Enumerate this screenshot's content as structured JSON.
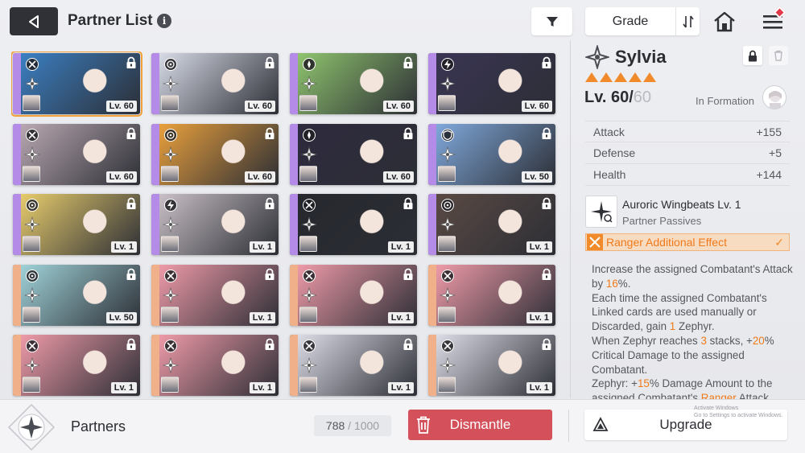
{
  "header": {
    "title": "Partner List",
    "info_icon": "info-icon",
    "grade_label": "Grade",
    "filter_icon": "filter-icon",
    "sort_icon": "sort-icon",
    "home_icon": "home-icon",
    "menu_icon": "menu-icon"
  },
  "partners": [
    {
      "level": "Lv. 60",
      "class": "crossed-swords",
      "stripe": "#b58be8",
      "art": "#3b7fc2",
      "selected": true
    },
    {
      "level": "Lv. 60",
      "class": "target",
      "stripe": "#b58be8",
      "art": "#d7dbe6"
    },
    {
      "level": "Lv. 60",
      "class": "compass",
      "stripe": "#b58be8",
      "art": "#8fc46e"
    },
    {
      "level": "Lv. 60",
      "class": "lightning",
      "stripe": "#b58be8",
      "art": "#3a3554"
    },
    {
      "level": "Lv. 60",
      "class": "crossed-swords",
      "stripe": "#b58be8",
      "art": "#b9a8b2"
    },
    {
      "level": "Lv. 60",
      "class": "target",
      "stripe": "#b58be8",
      "art": "#e9a03c"
    },
    {
      "level": "Lv. 60",
      "class": "compass",
      "stripe": "#b58be8",
      "art": "#2e2a3e"
    },
    {
      "level": "Lv. 50",
      "class": "shield",
      "stripe": "#b58be8",
      "art": "#7fa8db"
    },
    {
      "level": "Lv. 1",
      "class": "target",
      "stripe": "#b58be8",
      "art": "#e7cc6c"
    },
    {
      "level": "Lv. 1",
      "class": "lightning",
      "stripe": "#b58be8",
      "art": "#c9c0c6"
    },
    {
      "level": "Lv. 1",
      "class": "crossed-swords",
      "stripe": "#b58be8",
      "art": "#26282e"
    },
    {
      "level": "Lv. 1",
      "class": "target",
      "stripe": "#b58be8",
      "art": "#5a4a44"
    },
    {
      "level": "Lv. 50",
      "class": "target",
      "stripe": "#f0b08a",
      "art": "#9fd2d8"
    },
    {
      "level": "Lv. 1",
      "class": "crossed-swords",
      "stripe": "#f0b08a",
      "art": "#ee9aa8"
    },
    {
      "level": "Lv. 1",
      "class": "crossed-swords",
      "stripe": "#f0b08a",
      "art": "#ee9aa8"
    },
    {
      "level": "Lv. 1",
      "class": "crossed-swords",
      "stripe": "#f0b08a",
      "art": "#ee9aa8"
    },
    {
      "level": "Lv. 1",
      "class": "crossed-swords",
      "stripe": "#f0b08a",
      "art": "#ee9aa8"
    },
    {
      "level": "Lv. 1",
      "class": "crossed-swords",
      "stripe": "#f0b08a",
      "art": "#ee9aa8"
    },
    {
      "level": "Lv. 1",
      "class": "crossed-swords",
      "stripe": "#f0b08a",
      "art": "#dcdce6"
    },
    {
      "level": "Lv. 1",
      "class": "crossed-swords",
      "stripe": "#f0b08a",
      "art": "#dcdce6"
    }
  ],
  "detail": {
    "name": "Sylvia",
    "stars": 5,
    "level_current": "Lv. 60/",
    "level_max": "60",
    "in_formation": "In Formation",
    "stats": [
      {
        "label": "Attack",
        "value": "+155"
      },
      {
        "label": "Defense",
        "value": "+5"
      },
      {
        "label": "Health",
        "value": "+144"
      }
    ],
    "passive_name": "Auroric Wingbeats Lv. 1",
    "passive_sub": "Partner Passives",
    "effect_label": "Ranger Additional Effect",
    "description": {
      "p1a": "Increase the assigned Combatant's Attack by ",
      "p1n": "16",
      "p1b": "%.",
      "p2a": "Each time the assigned Combatant's Linked cards are used manually or Discarded, gain ",
      "p2n": "1",
      "p2b": " Zephyr.",
      "p3a": "When Zephyr reaches ",
      "p3n": "3",
      "p3b": " stacks, +",
      "p3n2": "20",
      "p3c": "% Critical Damage to the assigned Combatant.",
      "p4a": "Zephyr: +",
      "p4n": "15",
      "p4b": "% Damage Amount to the assigned Combatant's ",
      "p4n2": "Ranger",
      "p4c": " Attack"
    }
  },
  "bottom": {
    "partners_label": "Partners",
    "count": "788",
    "count_sep": " / ",
    "capacity": "1000",
    "dismantle_label": "Dismantle",
    "upgrade_label": "Upgrade",
    "watermark_line1": "Activate Windows",
    "watermark_line2": "Go to Settings to activate Windows."
  },
  "colors": {
    "accent_orange": "#f08a2a",
    "dismantle_red": "#d4505a",
    "dark_button": "#2f3137"
  }
}
